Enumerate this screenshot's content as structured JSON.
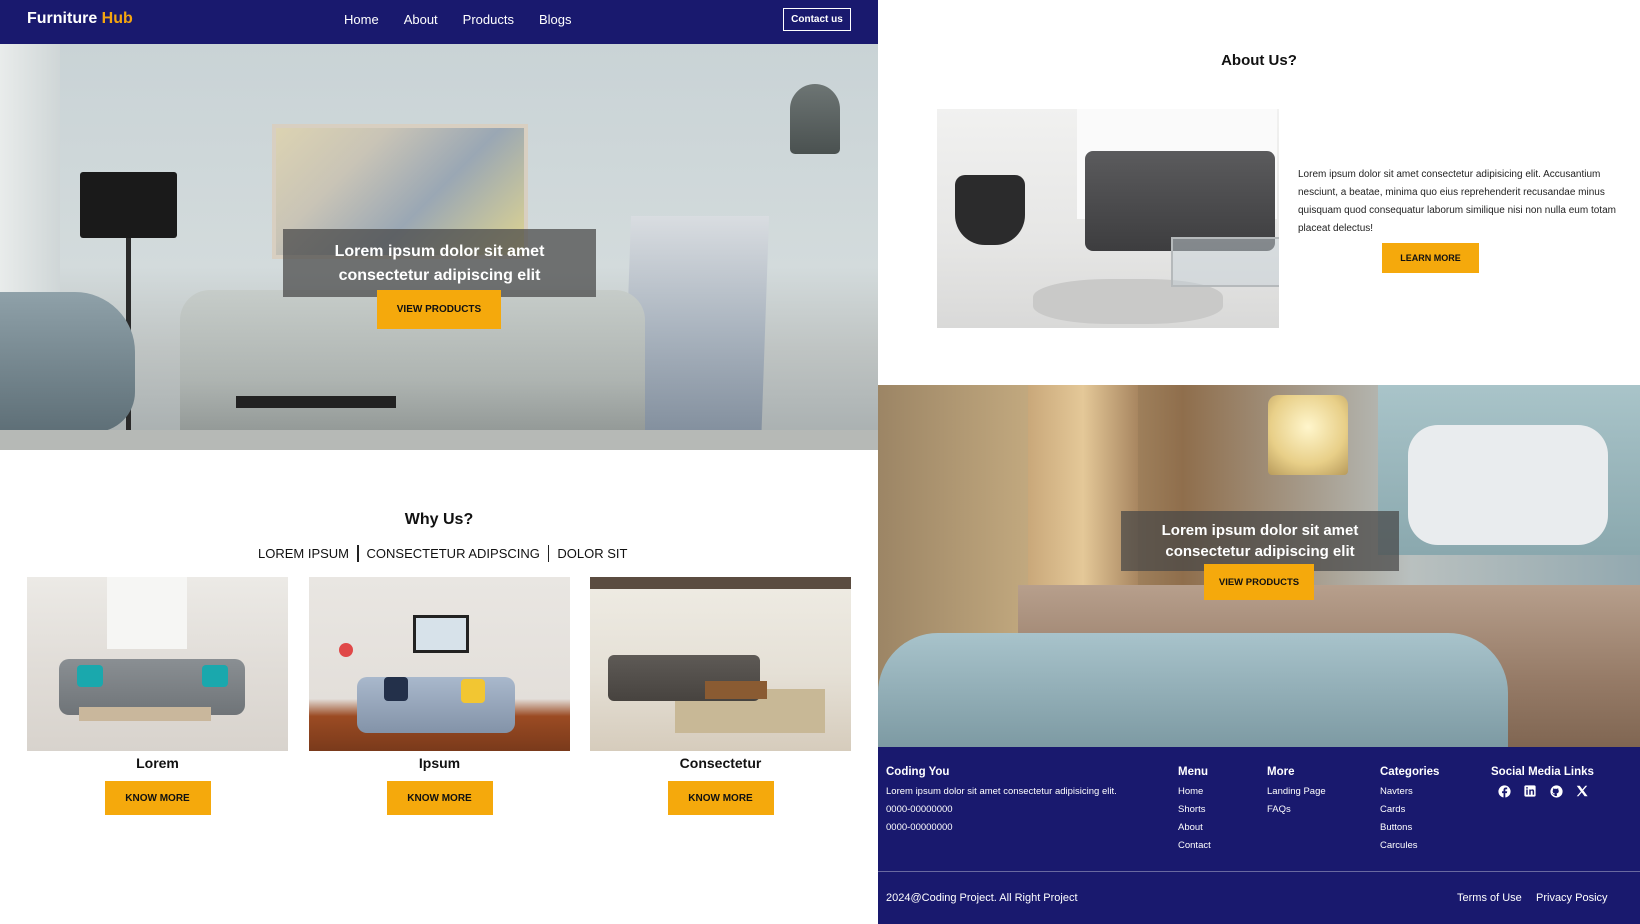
{
  "brand": {
    "name": "Furniture",
    "accent": "Hub",
    "accent_color": "#f5a510",
    "nav_color": "#19196e"
  },
  "nav": {
    "links": [
      "Home",
      "About",
      "Products",
      "Blogs"
    ],
    "contact": "Contact us"
  },
  "hero": {
    "line1": "Lorem ipsum dolor sit amet",
    "line2": "consectetur adipiscing elit",
    "button": "VIEW PRODUCTS"
  },
  "why": {
    "title": "Why Us?",
    "tabs": [
      "LOREM IPSUM",
      "CONSECTETUR ADIPSCING",
      "DOLOR SIT"
    ],
    "cards": [
      {
        "label": "Lorem",
        "button": "KNOW MORE"
      },
      {
        "label": "Ipsum",
        "button": "KNOW MORE"
      },
      {
        "label": "Consectetur",
        "button": "KNOW MORE"
      }
    ]
  },
  "about": {
    "title": "About Us?",
    "text": "Lorem ipsum dolor sit amet consectetur adipisicing elit. Accusantium nesciunt, a beatae, minima quo eius reprehenderit recusandae minus quisquam quod consequatur laborum similique nisi non nulla eum totam placeat delectus!",
    "button": "LEARN MORE"
  },
  "bedroom": {
    "line1": "Lorem ipsum dolor sit amet",
    "line2": "consectetur adipiscing elit",
    "button": "VIEW PRODUCTS"
  },
  "footer": {
    "company": {
      "title": "Coding You",
      "desc": "Lorem ipsum dolor sit amet consectetur adipisicing elit.",
      "phone1": "0000-00000000",
      "phone2": "0000-00000000"
    },
    "menu": {
      "title": "Menu",
      "items": [
        "Home",
        "Shorts",
        "About",
        "Contact"
      ]
    },
    "more": {
      "title": "More",
      "items": [
        "Landing Page",
        "FAQs"
      ]
    },
    "categories": {
      "title": "Categories",
      "items": [
        "Navters",
        "Cards",
        "Buttons",
        "Carcules"
      ]
    },
    "social": {
      "title": "Social Media Links",
      "icons": [
        "facebook-icon",
        "linkedin-icon",
        "github-icon",
        "x-icon"
      ]
    },
    "copyright": "2024@Coding Project. All Right Project",
    "terms": "Terms of Use",
    "privacy": "Privacy Posicy"
  }
}
